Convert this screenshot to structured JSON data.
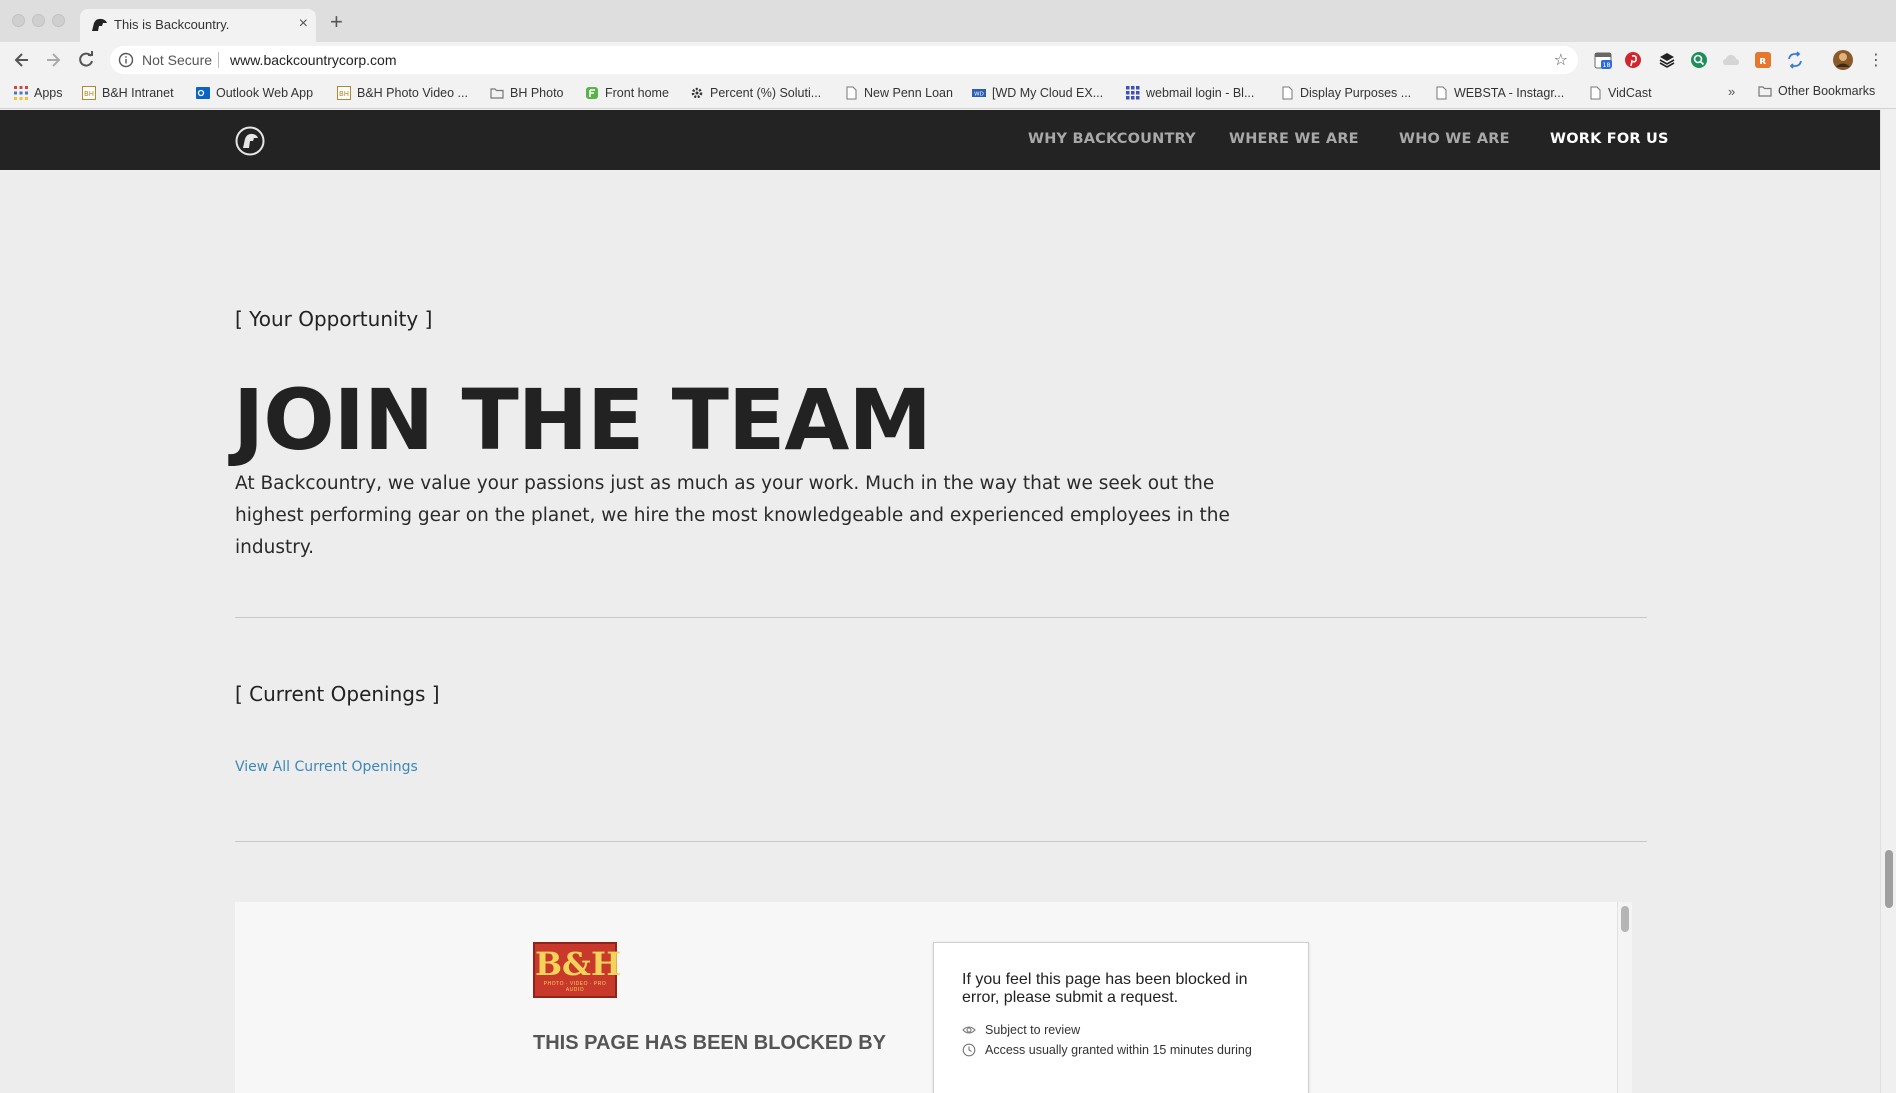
{
  "browser": {
    "tab": {
      "title": "This is Backcountry.",
      "close_glyph": "×"
    },
    "new_tab_glyph": "+",
    "address_bar": {
      "security_label": "Not Secure",
      "url": "www.backcountrycorp.com"
    },
    "bookmarks": [
      {
        "label": "Apps",
        "icon": "apps-grid-icon",
        "color": "#d44638"
      },
      {
        "label": "B&H Intranet",
        "icon": "bh-icon",
        "color": "#b8862b"
      },
      {
        "label": "Outlook Web App",
        "icon": "outlook-icon",
        "color": "#0a64c4"
      },
      {
        "label": "B&H Photo Video ...",
        "icon": "bh-icon",
        "color": "#b8862b"
      },
      {
        "label": "BH Photo",
        "icon": "folder-icon",
        "color": "#777777"
      },
      {
        "label": "Front home",
        "icon": "front-icon",
        "color": "#5ab24a"
      },
      {
        "label": "Percent (%) Soluti...",
        "icon": "gear-icon",
        "color": "#333333"
      },
      {
        "label": "New Penn Loan",
        "icon": "page-icon",
        "color": "#777777"
      },
      {
        "label": "[WD My Cloud EX...",
        "icon": "wd-icon",
        "color": "#2b5fb3"
      },
      {
        "label": "webmail login - Bl...",
        "icon": "grid-icon",
        "color": "#3f51b5"
      },
      {
        "label": "Display Purposes ...",
        "icon": "page-icon",
        "color": "#777777"
      },
      {
        "label": "WEBSTA - Instagr...",
        "icon": "page-icon",
        "color": "#777777"
      },
      {
        "label": "VidCast",
        "icon": "page-icon",
        "color": "#777777"
      }
    ],
    "overflow_glyph": "»",
    "other_bookmarks": "Other Bookmarks",
    "calendar_badge": "18"
  },
  "site": {
    "nav": [
      {
        "label": "WHY BACKCOUNTRY",
        "active": false
      },
      {
        "label": "WHERE WE ARE",
        "active": false
      },
      {
        "label": "WHO WE ARE",
        "active": false
      },
      {
        "label": "WORK FOR US",
        "active": true
      }
    ],
    "opportunity": {
      "eyebrow": "[ Your Opportunity ]",
      "headline": "JOIN THE TEAM",
      "body": "At Backcountry, we value your passions just as much as your work. Much in the way that we seek out the highest performing gear on the planet, we hire the most knowledgeable and experienced employees in the industry."
    },
    "openings": {
      "eyebrow": "[ Current Openings ]",
      "link": "View All Current Openings"
    },
    "embed": {
      "logo_letters": "B&H",
      "logo_tagline": "PHOTO · VIDEO · PRO AUDIO",
      "blocked_title": "THIS PAGE HAS BEEN BLOCKED BY",
      "request_text": "If you feel this page has been blocked in error, please submit a request.",
      "request_items": [
        {
          "icon": "eye-icon",
          "label": "Subject to review"
        },
        {
          "icon": "clock-icon",
          "label": "Access usually granted within 15 minutes during"
        }
      ]
    }
  },
  "colors": {
    "nav_bg": "#232323",
    "nav_link": "#a8a8a8",
    "nav_active": "#ffffff",
    "page_bg": "#ededed",
    "link": "#3d87b9",
    "bh_red": "#c9392b"
  }
}
